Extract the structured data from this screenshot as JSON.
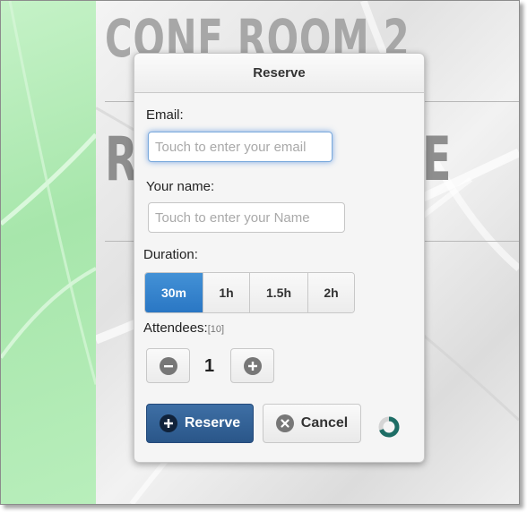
{
  "background": {
    "title": "CONF ROOM 2",
    "big_left": "R",
    "big_right": "E"
  },
  "dialog": {
    "title": "Reserve",
    "email": {
      "label": "Email:",
      "placeholder": "Touch to enter your email",
      "value": ""
    },
    "name": {
      "label": "Your name:",
      "placeholder": "Touch to enter your Name",
      "value": ""
    },
    "duration": {
      "label": "Duration:",
      "options": [
        "30m",
        "1h",
        "1.5h",
        "2h"
      ],
      "selected": "30m"
    },
    "attendees": {
      "label": "Attendees:",
      "limit": "[10]",
      "value": "1"
    },
    "reserve_label": "Reserve",
    "cancel_label": "Cancel"
  },
  "colors": {
    "accent": "#2a77c4",
    "primary_button": "#2a5689",
    "sidebar_green": "#a7e6ab",
    "spinner": "#1e6e66"
  },
  "icons": {
    "minus": "minus-circle-icon",
    "plus": "plus-circle-icon",
    "reserve": "plus-circle-icon",
    "cancel": "x-circle-icon",
    "loading": "loading-spinner-icon"
  }
}
